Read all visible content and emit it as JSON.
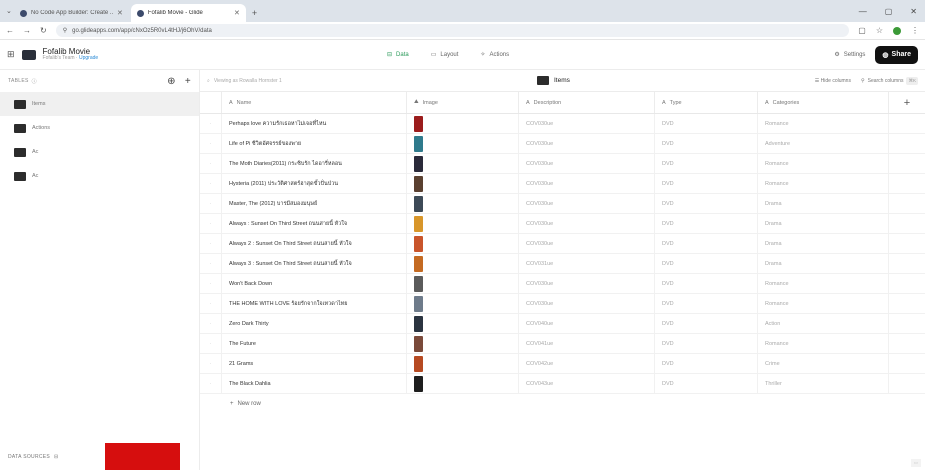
{
  "browser": {
    "tabs": [
      {
        "title": "No Code App Builder: Create ...",
        "active": false
      },
      {
        "title": "Fofalib Movie - Glide",
        "active": true
      }
    ],
    "url": "go.glideapps.com/app/cNxOz5R0vL4tHJ/j6OhV/data"
  },
  "app": {
    "title": "Fofalib Movie",
    "team": "Fofalib's Team",
    "upgrade_label": "Upgrade",
    "nav_tabs": [
      {
        "label": "Data",
        "active": true
      },
      {
        "label": "Layout",
        "active": false
      },
      {
        "label": "Actions",
        "active": false
      }
    ],
    "settings_label": "Settings",
    "share_label": "Share"
  },
  "sidebar": {
    "header": "TABLES",
    "tables": [
      {
        "label": "Items",
        "active": true
      },
      {
        "label": "Actions",
        "active": false
      },
      {
        "label": "Ac",
        "active": false
      },
      {
        "label": "Ac",
        "active": false
      }
    ],
    "footer": "DATA SOURCES",
    "accent_color": "#d60e0e"
  },
  "toolbar": {
    "filter_hint": "Viewing as Rowalla Hornster 1",
    "table_title": "Items",
    "hide_columns": "Hide columns",
    "search_placeholder": "Search columns",
    "shortcut": "⌘K"
  },
  "columns": [
    {
      "label": "Name",
      "icon": "text-icon"
    },
    {
      "label": "Image",
      "icon": "image-icon"
    },
    {
      "label": "Description",
      "icon": "text-icon"
    },
    {
      "label": "Type",
      "icon": "text-icon"
    },
    {
      "label": "Categories",
      "icon": "text-icon"
    }
  ],
  "rows": [
    {
      "name": "Perhaps love ความรักเธอหาไม่เจอที่ไหน",
      "desc": "COV030ue",
      "type": "DVD",
      "cat": "Romance",
      "poster": "#9b1c1c"
    },
    {
      "name": "Life of Pi ชีวิตอัศจรรย์ของพาย",
      "desc": "COV030ue",
      "type": "DVD",
      "cat": "Adventure",
      "poster": "#2f7a8c"
    },
    {
      "name": "The Moth Diaries(2011) กระซิบรัก ไดอารี่หลอน",
      "desc": "COV030ue",
      "type": "DVD",
      "cat": "Romance",
      "poster": "#2a2a3a"
    },
    {
      "name": "Hysteria (2011) ประวัติศาสตร์ฮาสุดขั้วปั่นป่วน",
      "desc": "COV030ue",
      "type": "DVD",
      "cat": "Romance",
      "poster": "#5a4030"
    },
    {
      "name": "Master, The (2012) บารมีสมองมนุษย์",
      "desc": "COV030ue",
      "type": "DVD",
      "cat": "Drama",
      "poster": "#3d4a57"
    },
    {
      "name": "Always : Sunset On Third Street ถนนสายนี้ หัวใจ",
      "desc": "COV030ue",
      "type": "DVD",
      "cat": "Drama",
      "poster": "#d8962a"
    },
    {
      "name": "Always 2 : Sunset On Third Street ถนนสายนี้ หัวใจ",
      "desc": "COV030ue",
      "type": "DVD",
      "cat": "Drama",
      "poster": "#c9552b"
    },
    {
      "name": "Always 3 : Sunset On Third Street ถนนสายนี้ หัวใจ",
      "desc": "COV031ue",
      "type": "DVD",
      "cat": "Drama",
      "poster": "#c46a22"
    },
    {
      "name": "Won't Back Down",
      "desc": "COV030ue",
      "type": "DVD",
      "cat": "Romance",
      "poster": "#5b5b5b"
    },
    {
      "name": "THE HOME WITH LOVE ร้อยรักจากใจเทวดาไทย",
      "desc": "COV030ue",
      "type": "DVD",
      "cat": "Romance",
      "poster": "#6e7b8a"
    },
    {
      "name": "Zero Dark Thirty",
      "desc": "COV040ue",
      "type": "DVD",
      "cat": "Action",
      "poster": "#2b3440"
    },
    {
      "name": "The Future",
      "desc": "COV041ue",
      "type": "DVD",
      "cat": "Romance",
      "poster": "#7a4a3a"
    },
    {
      "name": "21 Grams",
      "desc": "COV042ue",
      "type": "DVD",
      "cat": "Crime",
      "poster": "#b64a22"
    },
    {
      "name": "The Black Dahlia",
      "desc": "COV043ue",
      "type": "DVD",
      "cat": "Thriller",
      "poster": "#1e1e1e"
    }
  ],
  "new_row_label": "New row",
  "colors": {
    "accent_green": "#2b9a5a",
    "share_bg": "#111111"
  }
}
